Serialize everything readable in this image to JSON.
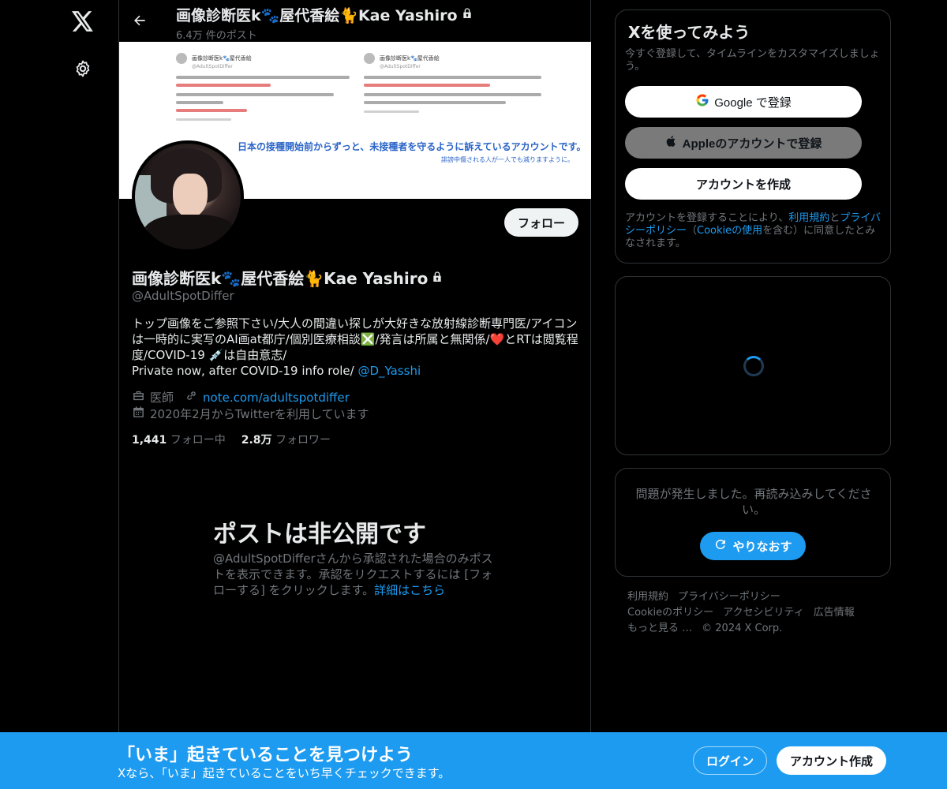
{
  "header": {
    "title": "画像診断医k🐾屋代香絵🐈Kae Yashiro",
    "post_count": "6.4万 件のポスト"
  },
  "banner": {
    "card1_name": "画像診断医k🐾屋代香絵",
    "card1_handle": "@AdultSpotDiffer",
    "card2_name": "画像診断医k🐾屋代香絵",
    "card2_handle": "@AdultSpotDiffer",
    "caption": "日本の接種開始前からずっと、未接種者を守るように訴えているアカウントです。",
    "caption_small": "誹謗中傷される人が一人でも減りますように。"
  },
  "profile": {
    "display_name": "画像診断医k🐾屋代香絵🐈Kae Yashiro",
    "handle": "@AdultSpotDiffer",
    "follow_label": "フォロー",
    "bio_text": "トップ画像をご参照下さい/大人の間違い探しが大好きな放射線診断専門医/アイコンは一時的に実写のAI画at都庁/個別医療相談❎/発言は所属と無関係/❤️とRTは閲覧程度/COVID-19 💉は自由意志/",
    "bio_line2": "Private now, after COVID-19 info role/ ",
    "bio_link": "@D_Yasshi",
    "profession": "医師",
    "website": "note.com/adultspotdiffer",
    "joined": "2020年2月からTwitterを利用しています",
    "following_count": "1,441",
    "following_label": "フォロー中",
    "followers_count": "2.8万",
    "followers_label": "フォロワー"
  },
  "private": {
    "title": "ポストは非公開です",
    "desc": "@AdultSpotDifferさんから承認された場合のみポストを表示できます。承認をリクエストするには [フォローする] をクリックします。",
    "link": "詳細はこちら"
  },
  "signup": {
    "title": "Xを使ってみよう",
    "subtitle": "今すぐ登録して、タイムラインをカスタマイズしましょう。",
    "google_label": "Google で登録",
    "apple_label": "Appleのアカウントで登録",
    "create_label": "アカウントを作成",
    "terms_pre": "アカウントを登録することにより、",
    "terms_link1": "利用規約",
    "terms_mid1": "と",
    "terms_link2": "プライバシーポリシー",
    "terms_mid2": "（",
    "terms_link3": "Cookieの使用",
    "terms_post": "を含む）に同意したとみなされます。"
  },
  "error": {
    "message": "問題が発生しました。再読み込みしてください。",
    "retry_label": "やりなおす"
  },
  "footer": {
    "terms": "利用規約",
    "privacy": "プライバシーポリシー",
    "cookie": "Cookieのポリシー",
    "accessibility": "アクセシビリティ",
    "ads": "広告情報",
    "more": "もっと見る …",
    "copyright": "© 2024 X Corp."
  },
  "bottombar": {
    "title": "「いま」起きていることを見つけよう",
    "subtitle": "Xなら、「いま」起きていることをいち早くチェックできます。",
    "login_label": "ログイン",
    "create_label": "アカウント作成"
  },
  "colors": {
    "accent": "#1d9bf0",
    "background": "#000000",
    "border": "#2f3336",
    "muted": "#71767b"
  }
}
